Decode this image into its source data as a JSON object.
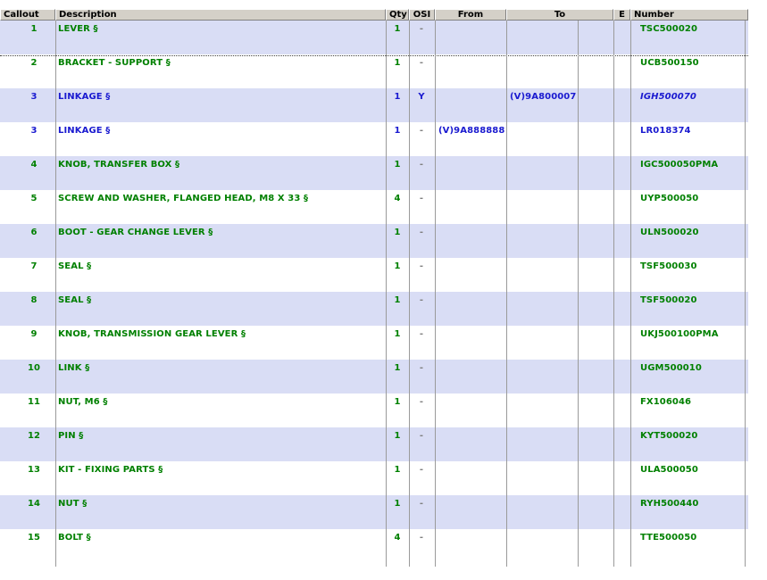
{
  "headers": {
    "callout": "Callout",
    "description": "Description",
    "qty": "Qty",
    "osi": "OSI",
    "from": "From",
    "to": "To",
    "e": "E",
    "number": "Number"
  },
  "colors": {
    "green_text": "#008000",
    "blue_text": "#1a1ad0",
    "alt_row": "#d9ddf5",
    "header_bg": "#d4d0c8"
  },
  "rows": [
    {
      "callout": "1",
      "description": "LEVER §",
      "qty": "1",
      "osi": "-",
      "from": "",
      "to": "",
      "e": "",
      "number": "TSC500020",
      "color": "green",
      "number_italic": false
    },
    {
      "callout": "2",
      "description": "BRACKET - SUPPORT §",
      "qty": "1",
      "osi": "-",
      "from": "",
      "to": "",
      "e": "",
      "number": "UCB500150",
      "color": "green",
      "number_italic": false
    },
    {
      "callout": "3",
      "description": "LINKAGE §",
      "qty": "1",
      "osi": "Y",
      "from": "",
      "to": "(V)9A800007",
      "e": "",
      "number": "IGH500070",
      "color": "blue",
      "number_italic": true
    },
    {
      "callout": "3",
      "description": "LINKAGE §",
      "qty": "1",
      "osi": "-",
      "from": "(V)9A888888",
      "to": "",
      "e": "",
      "number": "LR018374",
      "color": "blue",
      "number_italic": false
    },
    {
      "callout": "4",
      "description": "KNOB, TRANSFER BOX §",
      "qty": "1",
      "osi": "-",
      "from": "",
      "to": "",
      "e": "",
      "number": "IGC500050PMA",
      "color": "green",
      "number_italic": false
    },
    {
      "callout": "5",
      "description": "SCREW AND WASHER, FLANGED HEAD, M8 X 33 §",
      "qty": "4",
      "osi": "-",
      "from": "",
      "to": "",
      "e": "",
      "number": "UYP500050",
      "color": "green",
      "number_italic": false
    },
    {
      "callout": "6",
      "description": "BOOT - GEAR CHANGE LEVER §",
      "qty": "1",
      "osi": "-",
      "from": "",
      "to": "",
      "e": "",
      "number": "ULN500020",
      "color": "green",
      "number_italic": false
    },
    {
      "callout": "7",
      "description": "SEAL §",
      "qty": "1",
      "osi": "-",
      "from": "",
      "to": "",
      "e": "",
      "number": "TSF500030",
      "color": "green",
      "number_italic": false
    },
    {
      "callout": "8",
      "description": "SEAL §",
      "qty": "1",
      "osi": "-",
      "from": "",
      "to": "",
      "e": "",
      "number": "TSF500020",
      "color": "green",
      "number_italic": false
    },
    {
      "callout": "9",
      "description": "KNOB, TRANSMISSION GEAR LEVER §",
      "qty": "1",
      "osi": "-",
      "from": "",
      "to": "",
      "e": "",
      "number": "UKJ500100PMA",
      "color": "green",
      "number_italic": false
    },
    {
      "callout": "10",
      "description": "LINK §",
      "qty": "1",
      "osi": "-",
      "from": "",
      "to": "",
      "e": "",
      "number": "UGM500010",
      "color": "green",
      "number_italic": false
    },
    {
      "callout": "11",
      "description": "NUT, M6 §",
      "qty": "1",
      "osi": "-",
      "from": "",
      "to": "",
      "e": "",
      "number": "FX106046",
      "color": "green",
      "number_italic": false
    },
    {
      "callout": "12",
      "description": "PIN §",
      "qty": "1",
      "osi": "-",
      "from": "",
      "to": "",
      "e": "",
      "number": "KYT500020",
      "color": "green",
      "number_italic": false
    },
    {
      "callout": "13",
      "description": "KIT - FIXING PARTS §",
      "qty": "1",
      "osi": "-",
      "from": "",
      "to": "",
      "e": "",
      "number": "ULA500050",
      "color": "green",
      "number_italic": false
    },
    {
      "callout": "14",
      "description": "NUT §",
      "qty": "1",
      "osi": "-",
      "from": "",
      "to": "",
      "e": "",
      "number": "RYH500440",
      "color": "green",
      "number_italic": false
    },
    {
      "callout": "15",
      "description": "BOLT §",
      "qty": "4",
      "osi": "-",
      "from": "",
      "to": "",
      "e": "",
      "number": "TTE500050",
      "color": "green",
      "number_italic": false
    }
  ]
}
